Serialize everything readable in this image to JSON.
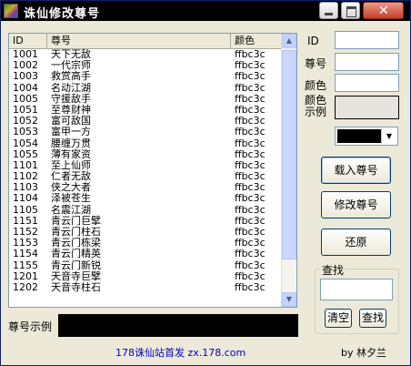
{
  "window": {
    "title": "诛仙修改尊号"
  },
  "titlebar_buttons": {
    "minimize": "minimize",
    "maximize": "maximize",
    "close": "close"
  },
  "list": {
    "columns": [
      "ID",
      "尊号",
      "颜色"
    ],
    "rows": [
      {
        "id": "1001",
        "name": "天下无敌",
        "color": "ffbc3c"
      },
      {
        "id": "1002",
        "name": "一代宗师",
        "color": "ffbc3c"
      },
      {
        "id": "1003",
        "name": "救赏高手",
        "color": "ffbc3c"
      },
      {
        "id": "1004",
        "name": "名动江湖",
        "color": "ffbc3c"
      },
      {
        "id": "1005",
        "name": "守援敌手",
        "color": "ffbc3c"
      },
      {
        "id": "1051",
        "name": "至尊财神",
        "color": "ffbc3c"
      },
      {
        "id": "1052",
        "name": "富可敌国",
        "color": "ffbc3c"
      },
      {
        "id": "1053",
        "name": "富甲一方",
        "color": "ffbc3c"
      },
      {
        "id": "1054",
        "name": "腰缠万贯",
        "color": "ffbc3c"
      },
      {
        "id": "1055",
        "name": "薄有家资",
        "color": "ffbc3c"
      },
      {
        "id": "1101",
        "name": "至上仙师",
        "color": "ffbc3c"
      },
      {
        "id": "1102",
        "name": "仁者无敌",
        "color": "ffbc3c"
      },
      {
        "id": "1103",
        "name": "侠之大者",
        "color": "ffbc3c"
      },
      {
        "id": "1104",
        "name": "泽被苍生",
        "color": "ffbc3c"
      },
      {
        "id": "1105",
        "name": "名震江湖",
        "color": "ffbc3c"
      },
      {
        "id": "1151",
        "name": "青云门巨擘",
        "color": "ffbc3c"
      },
      {
        "id": "1152",
        "name": "青云门柱石",
        "color": "ffbc3c"
      },
      {
        "id": "1153",
        "name": "青云门栋梁",
        "color": "ffbc3c"
      },
      {
        "id": "1154",
        "name": "青云门精英",
        "color": "ffbc3c"
      },
      {
        "id": "1155",
        "name": "青云门新锐",
        "color": "ffbc3c"
      },
      {
        "id": "1201",
        "name": "天音寺巨擘",
        "color": "ffbc3c"
      },
      {
        "id": "1202",
        "name": "天音寺柱石",
        "color": "ffbc3c"
      }
    ]
  },
  "form": {
    "id_label": "ID",
    "title_label": "尊号",
    "color_label": "颜色",
    "color_preview_label": "颜色示例",
    "selected_color": "#000000"
  },
  "buttons": {
    "load": "载入尊号",
    "modify": "修改尊号",
    "reset": "还原"
  },
  "search": {
    "group_label": "查找",
    "clear": "清空",
    "find": "查找"
  },
  "preview": {
    "label": "尊号示例"
  },
  "footer": {
    "link": "178诛仙站首发  zx.178.com",
    "author": "by 林夕兰"
  }
}
